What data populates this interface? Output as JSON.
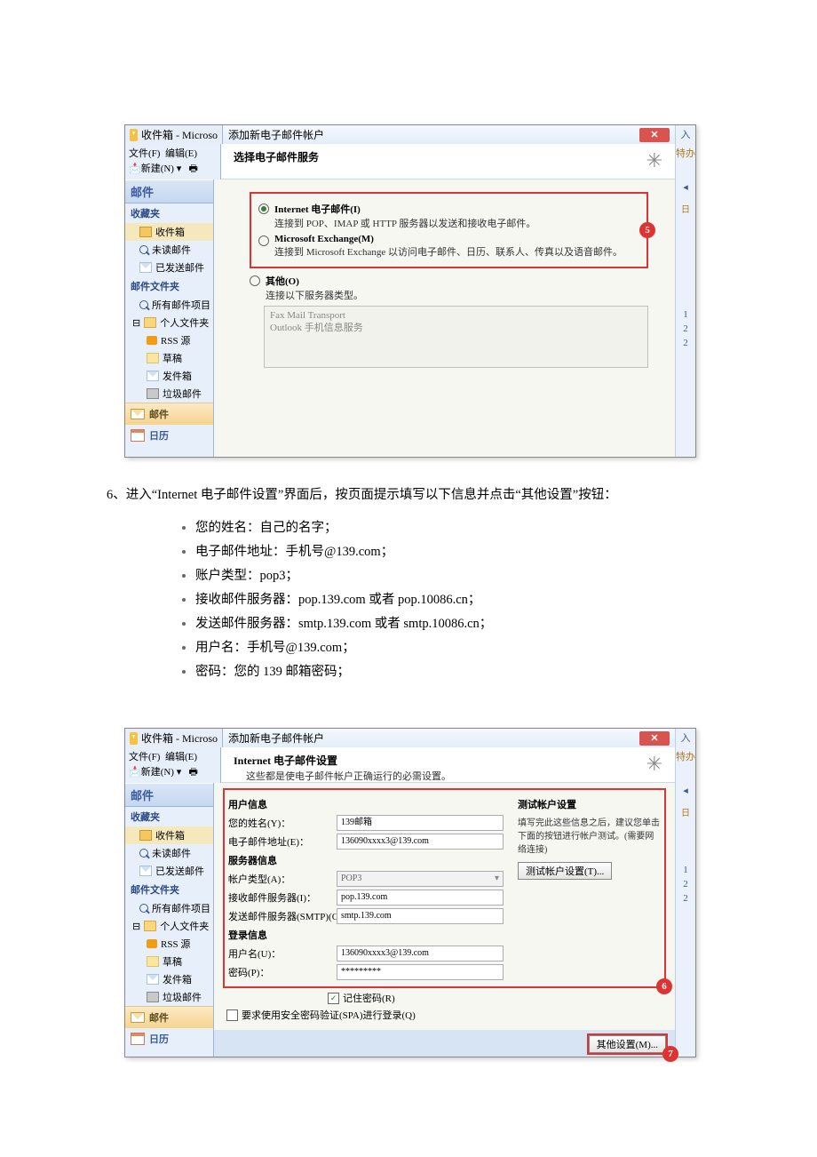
{
  "shot1": {
    "outlook_title": "收件箱 - Microso",
    "dialog_title": "添加新电子邮件帐户",
    "menu_file": "文件(F)",
    "menu_edit": "编辑(E)",
    "menu_new": "新建(N)",
    "dlg_head": "选择电子邮件服务",
    "side_top": "入",
    "side_mid": "特办",
    "side_tri": "◂",
    "side_n1": "1",
    "side_n2": "2",
    "side_n3": "2",
    "nav_mail": "邮件",
    "nav_fav": "收藏夹",
    "nav_inbox": "收件箱",
    "nav_unread": "未读邮件",
    "nav_sent": "已发送邮件",
    "nav_folders": "邮件文件夹",
    "nav_all": "所有邮件项目",
    "nav_personal": "个人文件夹",
    "nav_rss": "RSS 源",
    "nav_draft": "草稿",
    "nav_outbox": "发件箱",
    "nav_junk": "垃圾邮件",
    "nav_mail_btn": "邮件",
    "nav_cal": "日历",
    "opt1_title": "Internet 电子邮件(I)",
    "opt1_desc": "连接到 POP、IMAP 或 HTTP 服务器以发送和接收电子邮件。",
    "opt2_title": "Microsoft Exchange(M)",
    "opt2_desc": "连接到 Microsoft Exchange 以访问电子邮件、日历、联系人、传真以及语音邮件。",
    "opt3_title": "其他(O)",
    "opt3_desc": "连接以下服务器类型。",
    "srv1": "Fax Mail Transport",
    "srv2": "Outlook 手机信息服务",
    "badge5": "5"
  },
  "text_step6": "6、进入“Internet 电子邮件设置”界面后，按页面提示填写以下信息并点击“其他设置”按钮：",
  "bullets": {
    "b1": "  您的姓名：自己的名字；",
    "b2": "电子邮件地址：手机号@139.com；",
    "b3": "账户类型：pop3；",
    "b4": "接收邮件服务器：pop.139.com 或者 pop.10086.cn；",
    "b5": "发送邮件服务器：smtp.139.com 或者 smtp.10086.cn；",
    "b6": "用户名：手机号@139.com；",
    "b7": "密码：您的 139 邮箱密码；"
  },
  "shot2": {
    "dialog_title": "添加新电子邮件帐户",
    "dlg_head": "Internet 电子邮件设置",
    "dlg_sub": "这些都是使电子邮件帐户正确运行的必需设置。",
    "sec_user": "用户信息",
    "lbl_name": "您的姓名(Y)：",
    "val_name": "139邮箱",
    "lbl_email": "电子邮件地址(E)：",
    "val_email": "136090xxxx3@139.com",
    "sec_server": "服务器信息",
    "lbl_type": "帐户类型(A)：",
    "val_type": "POP3",
    "lbl_recv": "接收邮件服务器(I)：",
    "val_recv": "pop.139.com",
    "lbl_send": "发送邮件服务器(SMTP)(O)：",
    "val_send": "smtp.139.com",
    "sec_login": "登录信息",
    "lbl_user": "用户名(U)：",
    "val_user": "136090xxxx3@139.com",
    "lbl_pass": "密码(P)：",
    "val_pass": "*********",
    "chk_remember": "记住密码(R)",
    "chk_spa": "要求使用安全密码验证(SPA)进行登录(Q)",
    "sec_test": "测试帐户设置",
    "test_desc": "填写完此这些信息之后，建议您单击下面的按钮进行帐户测试。(需要网络连接)",
    "btn_test": "测试帐户设置(T)...",
    "btn_other": "其他设置(M)...",
    "badge6": "6",
    "badge7": "7"
  }
}
